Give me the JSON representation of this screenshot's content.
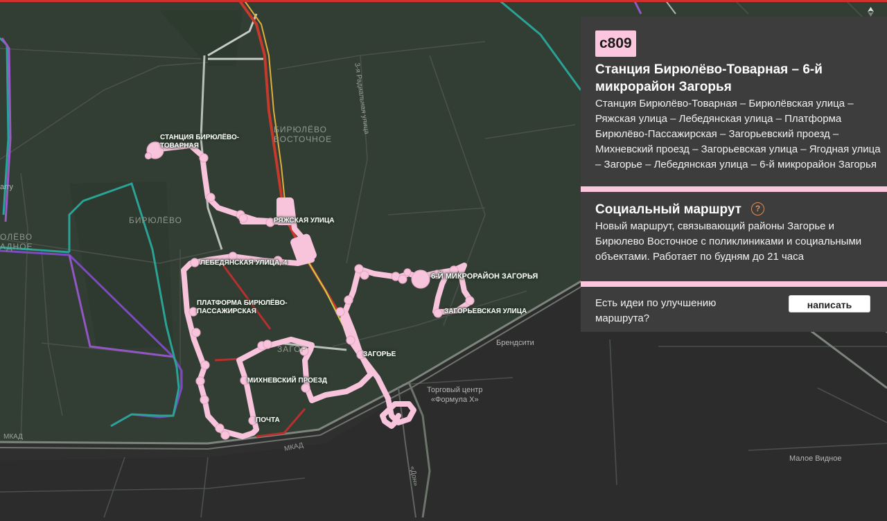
{
  "route": {
    "number": "с809",
    "title": "Станция Бирюлёво-Товарная – 6-й микрорайон Загорья",
    "stops_text": "Станция Бирюлёво-Товарная – Бирюлёвская улица – Ряжская улица – Лебедянская улица – Платформа Бирюлёво-Пассажирская – Загорьевский проезд – Михневский проезд – Загорьевская улица – Ягодная улица – Загорье – Лебедянская улица – 6-й микрорайон Загорья"
  },
  "social": {
    "title": "Социальный маршрут",
    "description": "Новый маршрут, связывающий районы Загорье и Бирюлево Восточное с поликлиниками и социальными объектами. Работает по будням до 21 часа"
  },
  "feedback": {
    "prompt": "Есть идеи по улучшению маршрута?",
    "button_label": "написать"
  },
  "map": {
    "stop_labels": {
      "birulevo_tovarnaya_1": "Станция Бирюлёво-",
      "birulevo_tovarnaya_2": "Товарная",
      "ryazhskaya": "Ряжская улица",
      "lebedyanskaya": "Лебедянская улица, 4",
      "platforma_1": "Платформа Бирюлёво-",
      "platforma_2": "Пассажирская",
      "zagorye_district": "Загор",
      "mikhnevsky": "Михневский проезд",
      "pochta": "Почта",
      "zagorye": "Загорье",
      "sixth_mkr": "6-й микрорайон Загорья",
      "zagoryevskaya": "Загорьевская улица"
    },
    "district_labels": {
      "birulevo_vostochnoe_1": "Бирюлёво",
      "birulevo_vostochnoe_2": "Восточное",
      "birulevo": "Бирюлёво",
      "left_edge_1": "олёво",
      "left_edge_2": "адное"
    },
    "place_labels": {
      "brendsiti": "Брендсити",
      "formula_1": "Торговый центр",
      "formula_2": "«Формула Х»",
      "maloe_vidnoe": "Малое Видное",
      "left_cut": "arry"
    },
    "road_labels": {
      "mkad_1": "МКАД",
      "mkad_2": "МКАД",
      "radialnaya": "3-я Радиальная улица",
      "don": "«Дон»"
    },
    "colors": {
      "background": "#2c2c2c",
      "green_area": "#323d33",
      "route": "#f7c4dc",
      "panel": "#3d3d3d",
      "accent_pink": "#fbc6de",
      "traffic_red": "#b5302f",
      "top_bar": "#d0312d"
    }
  }
}
